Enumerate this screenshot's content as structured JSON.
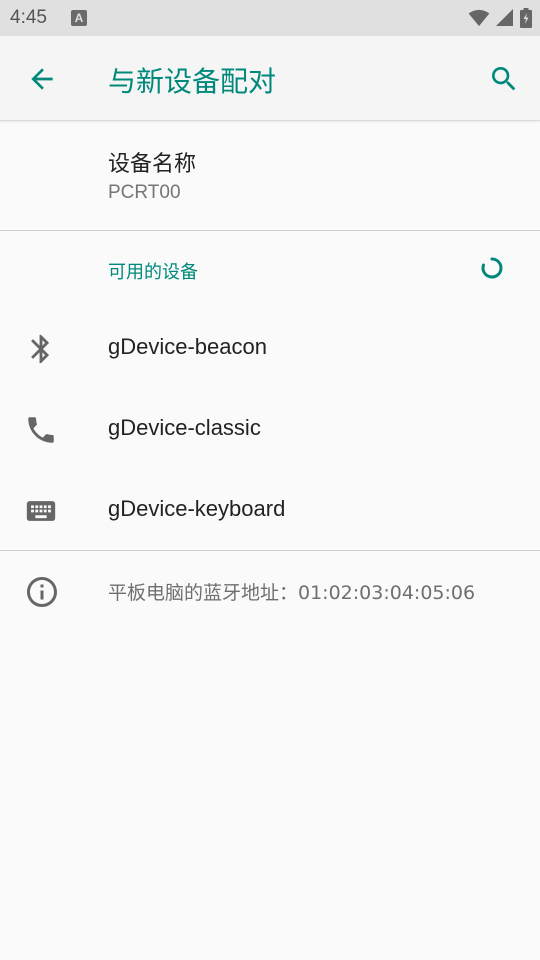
{
  "status_bar": {
    "time": "4:45",
    "notification_badge": "A",
    "icons": [
      "wifi-icon",
      "signal-icon",
      "battery-icon"
    ]
  },
  "app_bar": {
    "title": "与新设备配对",
    "back_icon": "arrow-back-icon",
    "search_icon": "search-icon",
    "accent_color": "#00897b"
  },
  "device_name": {
    "title": "设备名称",
    "value": "PCRT00"
  },
  "available": {
    "header": "可用的设备",
    "devices": [
      {
        "label": "gDevice-beacon",
        "icon": "bluetooth-icon"
      },
      {
        "label": "gDevice-classic",
        "icon": "phone-icon"
      },
      {
        "label": "gDevice-keyboard",
        "icon": "keyboard-icon"
      }
    ]
  },
  "footer": {
    "icon": "info-icon",
    "text": "平板电脑的蓝牙地址：01:02:03:04:05:06"
  }
}
